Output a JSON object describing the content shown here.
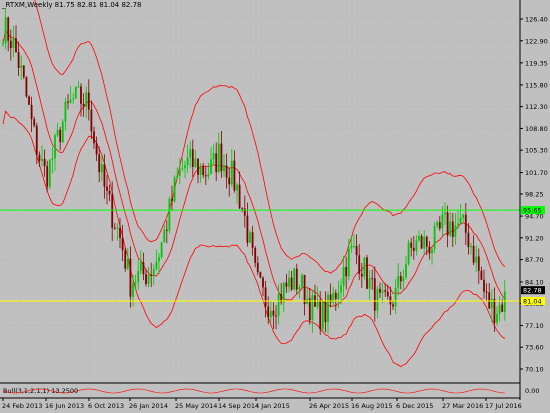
{
  "window": {
    "title": "_RTXM,Weekly  81.75 82.81 81.04 82.78",
    "subwindow_label": "Bull(3,1,2,1,1) 13.2500"
  },
  "price_axis": {
    "labels": [
      "126.40",
      "122.90",
      "119.35",
      "115.80",
      "112.30",
      "108.80",
      "105.30",
      "101.70",
      "98.25",
      "94.70",
      "91.20",
      "87.70",
      "84.10",
      "80.65",
      "77.10",
      "73.60",
      "70.10"
    ],
    "min": 70.1,
    "max": 126.4,
    "current_price": "82.78",
    "green_level_label": "95.65",
    "yellow_level_label": "81.04",
    "subwindow_zero": "0.00"
  },
  "time_axis": {
    "labels": [
      "24 Feb 2013",
      "16 Jun 2013",
      "6 Oct 2013",
      "26 Jan 2014",
      "25 May 2014",
      "14 Sep 2014",
      "4 Jan 2015",
      "26 Apr 2015",
      "16 Aug 2015",
      "6 Dec 2015",
      "27 Mar 2016",
      "17 Jul 2016"
    ]
  },
  "colors": {
    "background": "#c0c0c0",
    "bull_candle": "#00c800",
    "bear_candle": "#800000",
    "bands": "#ff0000",
    "green_line": "#00ff00",
    "yellow_line": "#ffff00",
    "grid": "#a8a8a8"
  },
  "chart_data": {
    "type": "candlestick",
    "symbol": "_RTXM",
    "timeframe": "Weekly",
    "last_bar": {
      "open": 81.75,
      "high": 82.81,
      "low": 81.04,
      "close": 82.78
    },
    "horizontal_levels": [
      95.65,
      81.04
    ],
    "close_path": [
      [
        "24 Feb 2013",
        124.0
      ],
      [
        "16 Jun 2013",
        104.0
      ],
      [
        "6 Oct 2013",
        114.0
      ],
      [
        "26 Jan 2014",
        81.0
      ],
      [
        "25 May 2014",
        98.0
      ],
      [
        "14 Sep 2014",
        107.0
      ],
      [
        "4 Jan 2015",
        85.0
      ],
      [
        "26 Apr 2015",
        80.0
      ],
      [
        "16 Aug 2015",
        86.0
      ],
      [
        "6 Dec 2015",
        82.0
      ],
      [
        "27 Mar 2016",
        96.0
      ],
      [
        "17 Jul 2016",
        83.0
      ]
    ]
  }
}
